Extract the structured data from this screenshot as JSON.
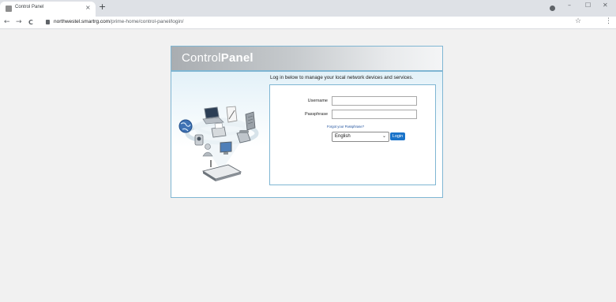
{
  "browser": {
    "tab_title": "Control Panel",
    "tab_close": "×",
    "new_tab": "+",
    "minimize": "–",
    "maximize": "☐",
    "close": "✕",
    "back": "←",
    "forward": "→",
    "reload": "C",
    "url_host": "northwestel.smartrg.com",
    "url_path": "/prime-home/control-panel/login/",
    "star": "☆",
    "menu": "⋮"
  },
  "panel": {
    "title_light": "Control",
    "title_bold": "Panel",
    "intro": "Log in below to manage your local network devices and services."
  },
  "login": {
    "username_label": "Username",
    "username_value": "",
    "passphrase_label": "Passphrase",
    "passphrase_value": "",
    "forgot_link": "Forgot your Passphrase?",
    "language_selected": "English",
    "login_button": "Login"
  },
  "colors": {
    "accent": "#1a73c9",
    "panel_border": "#7fb6d3",
    "page_bg": "#f1f1f1"
  },
  "icons": [
    "globe-icon",
    "laptop-icon",
    "document-icon",
    "server-icon",
    "camera-icon",
    "printer-icon",
    "phone-icon",
    "monitor-icon",
    "router-icon"
  ]
}
